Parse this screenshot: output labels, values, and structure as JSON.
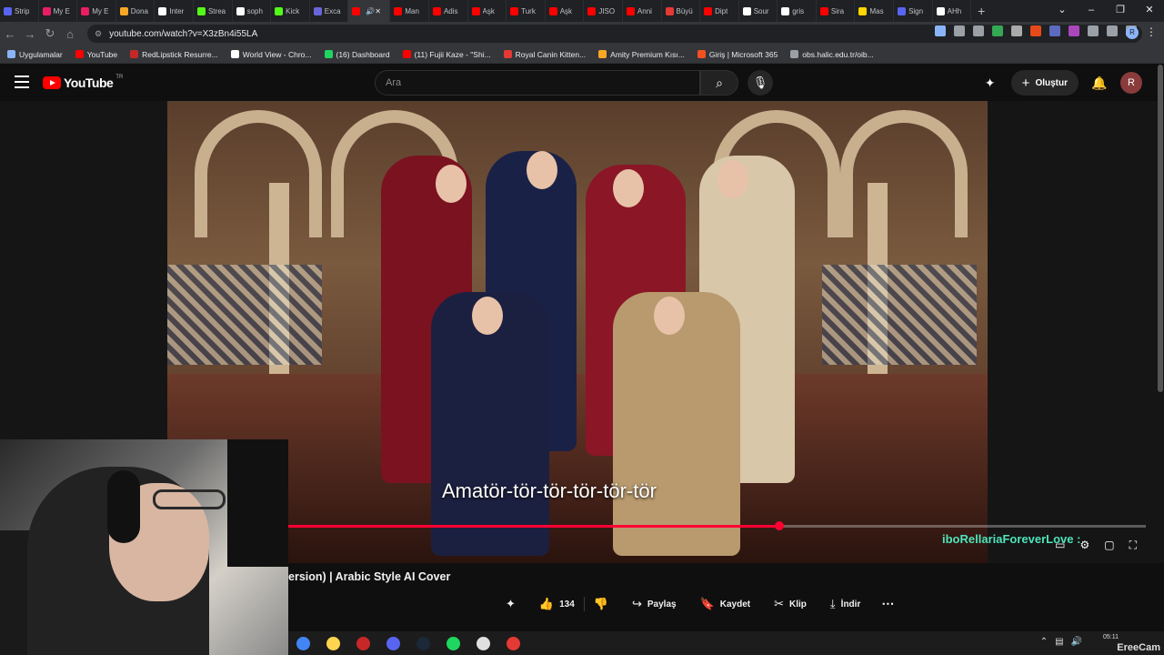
{
  "browser": {
    "tabs": [
      {
        "title": "Strip",
        "color": "#5865f2"
      },
      {
        "title": "My E",
        "color": "#e91e63"
      },
      {
        "title": "My E",
        "color": "#e91e63"
      },
      {
        "title": "Dona",
        "color": "#f9a825"
      },
      {
        "title": "Inter",
        "color": "#ffffff"
      },
      {
        "title": "Strea",
        "color": "#53fc18"
      },
      {
        "title": "soph",
        "color": "#ffffff"
      },
      {
        "title": "Kick",
        "color": "#53fc18"
      },
      {
        "title": "Exca",
        "color": "#6965db"
      },
      {
        "title": "",
        "color": "#ff0000",
        "active": true
      },
      {
        "title": "Man",
        "color": "#ff0000"
      },
      {
        "title": "Adis",
        "color": "#ff0000"
      },
      {
        "title": "Aşk",
        "color": "#ff0000"
      },
      {
        "title": "Turk",
        "color": "#ff0000"
      },
      {
        "title": "Aşk",
        "color": "#ff0000"
      },
      {
        "title": "JISO",
        "color": "#ff0000"
      },
      {
        "title": "Anni",
        "color": "#ff0000"
      },
      {
        "title": "Büyü",
        "color": "#e53935"
      },
      {
        "title": "Dipt",
        "color": "#ff0000"
      },
      {
        "title": "Sour",
        "color": "#ffffff"
      },
      {
        "title": "gris",
        "color": "#ffffff"
      },
      {
        "title": "Sira",
        "color": "#ff0000"
      },
      {
        "title": "Mas",
        "color": "#ffd600"
      },
      {
        "title": "Sign",
        "color": "#5865f2"
      },
      {
        "title": "AHh",
        "color": "#ffffff"
      }
    ],
    "url": "youtube.com/watch?v=X3zBn4i55LA",
    "bookmarks": [
      {
        "label": "Uygulamalar",
        "color": "#8ab4f8"
      },
      {
        "label": "YouTube",
        "color": "#ff0000"
      },
      {
        "label": "RedLipstick Resurre...",
        "color": "#c62828"
      },
      {
        "label": "World View - Chro...",
        "color": "#ffffff"
      },
      {
        "label": "(16) Dashboard",
        "color": "#1ed760"
      },
      {
        "label": "(11) Fujii Kaze - \"Shi...",
        "color": "#ff0000"
      },
      {
        "label": "Royal Canin Kitten...",
        "color": "#e53935"
      },
      {
        "label": "Amity Premium Kısı...",
        "color": "#f9a825"
      },
      {
        "label": "Giriş | Microsoft 365",
        "color": "#f25022"
      },
      {
        "label": "obs.halic.edu.tr/oib...",
        "color": "#9aa0a6"
      }
    ],
    "profile_initial": "R"
  },
  "youtube": {
    "logo_text": "YouTube",
    "logo_region": "TR",
    "search_placeholder": "Ara",
    "create_label": "Oluştur",
    "avatar_initial": "R",
    "subtitle": "Amatör-tör-tör-tör-tör-tör",
    "progress_fraction": 0.573,
    "channel_overlay": "iboRellariaForeverLove :",
    "video_title": "ersion) | Arabic Style AI Cover",
    "like_count": "134",
    "actions": {
      "share": "Paylaş",
      "save": "Kaydet",
      "clip": "Klip",
      "download": "İndir"
    }
  },
  "taskbar": {
    "apps": [
      {
        "name": "chrome",
        "color": "#4285f4"
      },
      {
        "name": "files",
        "color": "#ffd54f"
      },
      {
        "name": "voicemeeter",
        "color": "#c62828"
      },
      {
        "name": "discord",
        "color": "#5865f2"
      },
      {
        "name": "steam",
        "color": "#1b2838"
      },
      {
        "name": "spotify",
        "color": "#1ed760"
      },
      {
        "name": "obs",
        "color": "#e0e0e0"
      },
      {
        "name": "app",
        "color": "#e53935"
      }
    ],
    "time": "05:11"
  },
  "watermark": "EreeCam"
}
